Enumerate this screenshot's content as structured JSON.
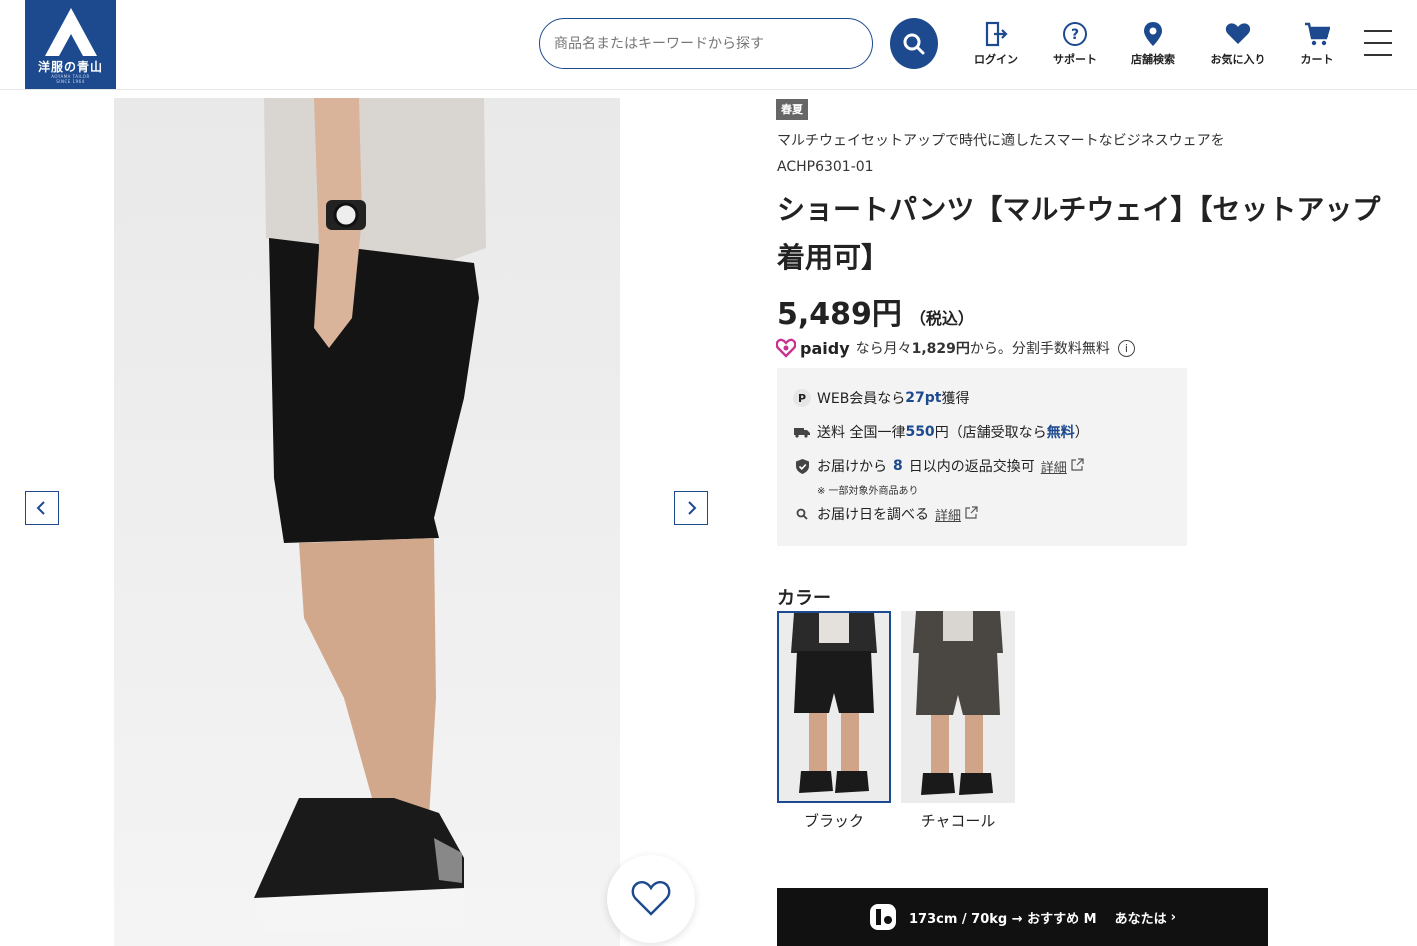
{
  "header": {
    "logo_text": "洋服の青山",
    "logo_sub1": "AOYAMA TAILOR",
    "logo_sub2": "SINCE 1964",
    "search_placeholder": "商品名またはキーワードから探す",
    "nav": [
      {
        "label": "ログイン",
        "icon": "login-icon"
      },
      {
        "label": "サポート",
        "icon": "help-icon"
      },
      {
        "label": "店舗検索",
        "icon": "location-pin-icon"
      },
      {
        "label": "お気に入り",
        "icon": "heart-icon"
      },
      {
        "label": "カート",
        "icon": "cart-icon"
      }
    ],
    "brand_color": "#1d4a8f"
  },
  "product": {
    "season_tag": "春夏",
    "catch_copy": "マルチウェイセットアップで時代に適したスマートなビジネスウェアを",
    "sku": "ACHP6301-01",
    "title": "ショートパンツ【マルチウェイ】【セットアップ着用可】",
    "price": "5,489円",
    "tax_label": "（税込）",
    "paidy": {
      "brand": "paidy",
      "text_prefix": "なら月々",
      "monthly": "1,829円",
      "text_suffix": "から。分割手数料無料"
    },
    "info": {
      "points_prefix": "WEB会員なら",
      "points_value": "27pt",
      "points_suffix": "獲得",
      "shipping_prefix": "送料 全国一律",
      "shipping_value": "550",
      "shipping_mid": "円（店舗受取なら",
      "shipping_free": "無料",
      "shipping_suffix": "）",
      "return_prefix": "お届けから",
      "return_days": "8",
      "return_suffix": "日以内の返品交換可",
      "return_link": "詳細",
      "return_note": "※ 一部対象外商品あり",
      "delivery_text": "お届け日を調べる",
      "delivery_link": "詳細"
    },
    "color_label": "カラー",
    "colors": [
      {
        "name": "ブラック",
        "selected": true,
        "color": "#1a1a1a"
      },
      {
        "name": "チャコール",
        "selected": false,
        "color": "#4a4742"
      }
    ],
    "fit_bar": {
      "text": "173cm / 70kg → おすすめ M",
      "cta": "あなたは"
    }
  }
}
